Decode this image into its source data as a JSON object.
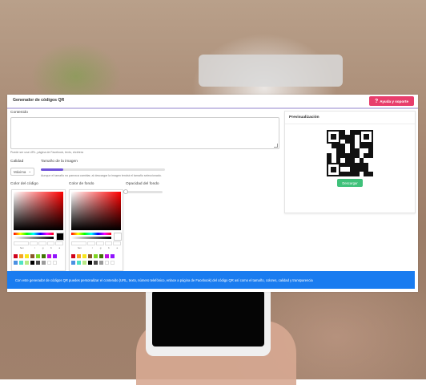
{
  "app": {
    "title": "Generador de códigos QR",
    "help_button": {
      "icon": "question-icon",
      "label": "Ayuda y soporte"
    }
  },
  "form": {
    "content_label": "Contenido",
    "content_value": "",
    "content_hint": "Puede ser una URL, página de Facebook, texto, etcétera",
    "quality_label": "Calidad",
    "quality_selected": "Máxima",
    "size_label": "Tamaño de la imagen",
    "size_level": 0.18,
    "size_hint": "Aunque el tamaño no parezca cambiar, al descargar la imagen tendrá el tamaño seleccionado.",
    "opacity_label": "Opacidad del fondo",
    "opacity_level": 0,
    "code_color_label": "Color del código",
    "bg_color_label": "Color de fondo",
    "code_color_hex": "#000000",
    "bg_color_hex": "#ffffff",
    "channel_labels": [
      "hex",
      "r",
      "g",
      "b",
      "a"
    ],
    "swatches_row1": [
      "#d0021b",
      "#f5a623",
      "#f8e71c",
      "#8b572a",
      "#7ed321",
      "#417505",
      "#bd10e0",
      "#9013fe"
    ],
    "swatches_row2": [
      "#4a90e2",
      "#50e3c2",
      "#b8e986",
      "#000000",
      "#4a4a4a",
      "#9b9b9b",
      "#ffffff",
      "#ffffff"
    ]
  },
  "preview": {
    "title": "Previsualización",
    "download_label": "Descargar"
  },
  "info_bar": {
    "text": "Con este generador de códigos QR puedes personalizar el contenido (URL, texto, número telefónico, enlace a página de Facebook) del código QR así como el tamaño, colores, calidad y transparencia"
  },
  "colors": {
    "accent": "#6f52d9",
    "help_button": "#e83e6c",
    "download_button": "#3fc17a",
    "info_bar": "#1a7cf0"
  }
}
